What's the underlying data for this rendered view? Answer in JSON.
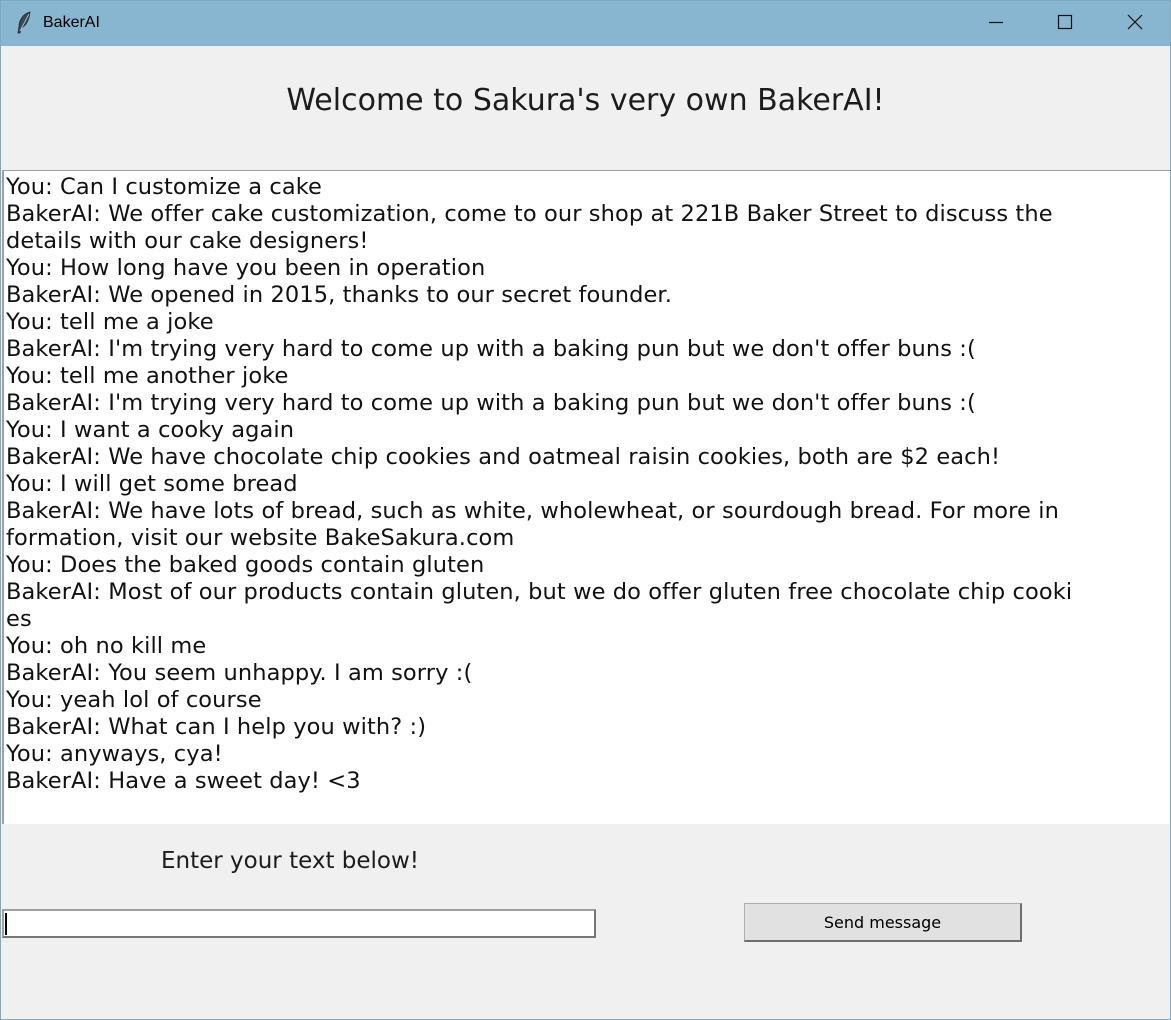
{
  "window": {
    "title": "BakerAI",
    "app_icon": "feather-icon",
    "controls": [
      "minimize-icon",
      "maximize-icon",
      "close-icon"
    ]
  },
  "header": {
    "title": "Welcome to Sakura's very own BakerAI!"
  },
  "chat": {
    "lines": [
      "You: Can I customize a cake",
      "BakerAI: We offer cake customization, come to our shop at 221B Baker Street to discuss the",
      "details with our cake designers!",
      "You: How long have you been in operation",
      "BakerAI: We opened in 2015, thanks to our secret founder.",
      "You: tell me a joke",
      "BakerAI: I'm trying very hard to come up with a baking pun but we don't offer buns :(",
      "You: tell me another joke",
      "BakerAI: I'm trying very hard to come up with a baking pun but we don't offer buns :(",
      "You: I want a cooky again",
      "BakerAI: We have chocolate chip cookies and oatmeal raisin cookies, both are $2 each!",
      "You: I will get some bread",
      "BakerAI: We have lots of bread, such as white, wholewheat, or sourdough bread. For more in",
      "formation, visit our website BakeSakura.com",
      "You: Does the baked goods contain gluten",
      "BakerAI: Most of our products contain gluten, but we do offer gluten free chocolate chip cooki",
      "es",
      "You: oh no kill me",
      "BakerAI: You seem unhappy. I am sorry :(",
      "You: yeah lol of course",
      "BakerAI: What can I help you with? :)",
      "You: anyways, cya!",
      "BakerAI: Have a sweet day! <3"
    ]
  },
  "input": {
    "prompt": "Enter your text below!",
    "value": "",
    "send_label": "Send message"
  }
}
